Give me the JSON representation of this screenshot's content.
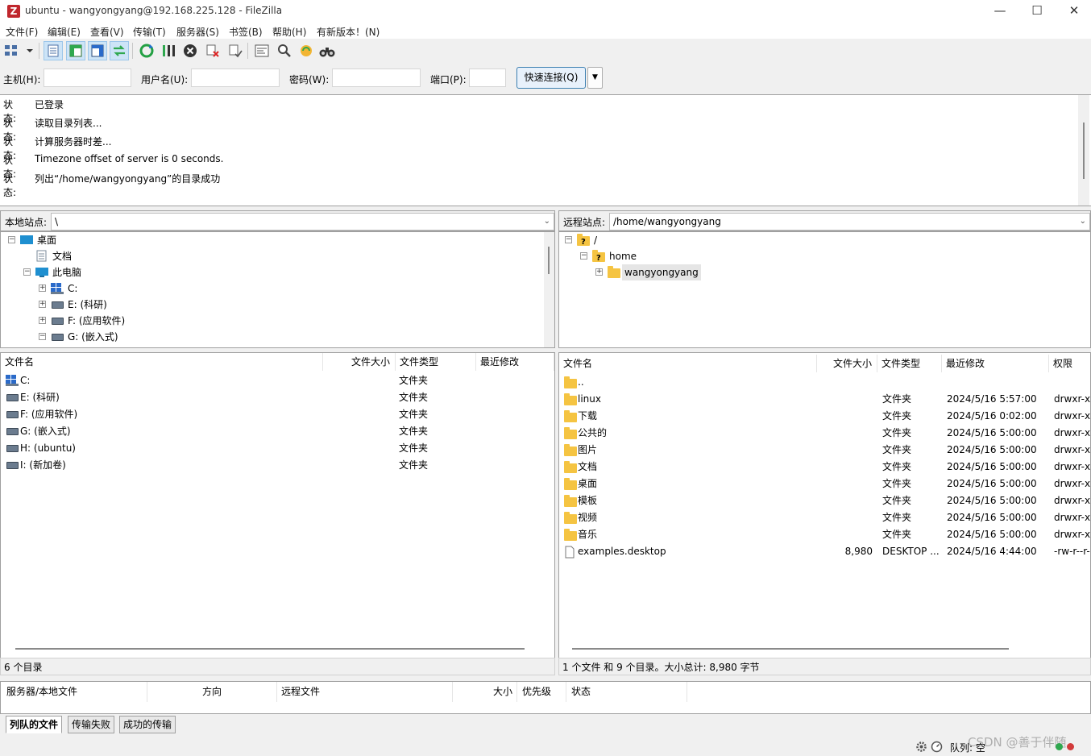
{
  "window": {
    "title": "ubuntu - wangyongyang@192.168.225.128 - FileZilla",
    "app_icon": "Z"
  },
  "menu": [
    "文件(F)",
    "编辑(E)",
    "查看(V)",
    "传输(T)",
    "服务器(S)",
    "书签(B)",
    "帮助(H)",
    "有新版本！(N)"
  ],
  "quickconnect": {
    "host_label": "主机(H):",
    "user_label": "用户名(U):",
    "pass_label": "密码(W):",
    "port_label": "端口(P):",
    "host_value": "",
    "user_value": "",
    "pass_value": "",
    "port_value": "",
    "connect_label": "快速连接(Q)"
  },
  "log": [
    {
      "k": "状态:",
      "v": "已登录"
    },
    {
      "k": "状态:",
      "v": "读取目录列表..."
    },
    {
      "k": "状态:",
      "v": "计算服务器时差..."
    },
    {
      "k": "状态:",
      "v": "Timezone offset of server is 0 seconds."
    },
    {
      "k": "状态:",
      "v": "列出“/home/wangyongyang”的目录成功"
    }
  ],
  "local": {
    "site_label": "本地站点:",
    "path": "\\",
    "tree": [
      {
        "label": "桌面",
        "icon": "desktop",
        "indent": 0,
        "exp": "-"
      },
      {
        "label": "文档",
        "icon": "doc",
        "indent": 1,
        "exp": ""
      },
      {
        "label": "此电脑",
        "icon": "desktop",
        "indent": 1,
        "exp": "-"
      },
      {
        "label": "C:",
        "icon": "drive-c",
        "indent": 2,
        "exp": "+"
      },
      {
        "label": "E: (科研)",
        "icon": "drive",
        "indent": 2,
        "exp": "+"
      },
      {
        "label": "F: (应用软件)",
        "icon": "drive",
        "indent": 2,
        "exp": "+"
      },
      {
        "label": "G: (嵌入式)",
        "icon": "drive",
        "indent": 2,
        "exp": "-"
      }
    ],
    "columns": [
      "文件名",
      "文件大小",
      "文件类型",
      "最近修改"
    ],
    "files": [
      {
        "name": "C:",
        "icon": "drive-c",
        "size": "",
        "type": "文件夹",
        "modified": ""
      },
      {
        "name": "E: (科研)",
        "icon": "drive",
        "size": "",
        "type": "文件夹",
        "modified": ""
      },
      {
        "name": "F: (应用软件)",
        "icon": "drive",
        "size": "",
        "type": "文件夹",
        "modified": ""
      },
      {
        "name": "G: (嵌入式)",
        "icon": "drive",
        "size": "",
        "type": "文件夹",
        "modified": ""
      },
      {
        "name": "H: (ubuntu)",
        "icon": "drive",
        "size": "",
        "type": "文件夹",
        "modified": ""
      },
      {
        "name": "I: (新加卷)",
        "icon": "drive",
        "size": "",
        "type": "文件夹",
        "modified": ""
      }
    ],
    "status": "6 个目录"
  },
  "remote": {
    "site_label": "远程站点:",
    "path": "/home/wangyongyang",
    "tree": [
      {
        "label": "/",
        "icon": "unknown",
        "indent": 0,
        "exp": "-"
      },
      {
        "label": "home",
        "icon": "unknown",
        "indent": 1,
        "exp": "-"
      },
      {
        "label": "wangyongyang",
        "icon": "folder",
        "indent": 2,
        "exp": "+"
      }
    ],
    "columns": [
      "文件名",
      "文件大小",
      "文件类型",
      "最近修改",
      "权限"
    ],
    "files": [
      {
        "name": "..",
        "icon": "folder",
        "size": "",
        "type": "",
        "modified": "",
        "perm": ""
      },
      {
        "name": "linux",
        "icon": "folder",
        "size": "",
        "type": "文件夹",
        "modified": "2024/5/16 5:57:00",
        "perm": "drwxr-xr"
      },
      {
        "name": "下载",
        "icon": "folder",
        "size": "",
        "type": "文件夹",
        "modified": "2024/5/16 0:02:00",
        "perm": "drwxr-xr"
      },
      {
        "name": "公共的",
        "icon": "folder",
        "size": "",
        "type": "文件夹",
        "modified": "2024/5/16 5:00:00",
        "perm": "drwxr-xr"
      },
      {
        "name": "图片",
        "icon": "folder",
        "size": "",
        "type": "文件夹",
        "modified": "2024/5/16 5:00:00",
        "perm": "drwxr-xr"
      },
      {
        "name": "文档",
        "icon": "folder",
        "size": "",
        "type": "文件夹",
        "modified": "2024/5/16 5:00:00",
        "perm": "drwxr-xr"
      },
      {
        "name": "桌面",
        "icon": "folder",
        "size": "",
        "type": "文件夹",
        "modified": "2024/5/16 5:00:00",
        "perm": "drwxr-xr"
      },
      {
        "name": "模板",
        "icon": "folder",
        "size": "",
        "type": "文件夹",
        "modified": "2024/5/16 5:00:00",
        "perm": "drwxr-xr"
      },
      {
        "name": "视频",
        "icon": "folder",
        "size": "",
        "type": "文件夹",
        "modified": "2024/5/16 5:00:00",
        "perm": "drwxr-xr"
      },
      {
        "name": "音乐",
        "icon": "folder",
        "size": "",
        "type": "文件夹",
        "modified": "2024/5/16 5:00:00",
        "perm": "drwxr-xr"
      },
      {
        "name": "examples.desktop",
        "icon": "file",
        "size": "8,980",
        "type": "DESKTOP ...",
        "modified": "2024/5/16 4:44:00",
        "perm": "-rw-r--r-"
      }
    ],
    "status": "1 个文件 和 9 个目录。大小总计: 8,980 字节"
  },
  "queue": {
    "columns": [
      "服务器/本地文件",
      "方向",
      "远程文件",
      "大小",
      "优先级",
      "状态"
    ],
    "tabs": [
      "列队的文件",
      "传输失败",
      "成功的传输"
    ]
  },
  "statusbar": {
    "queue_text": "队列: 空",
    "watermark": "CSDN @善于伴随"
  }
}
